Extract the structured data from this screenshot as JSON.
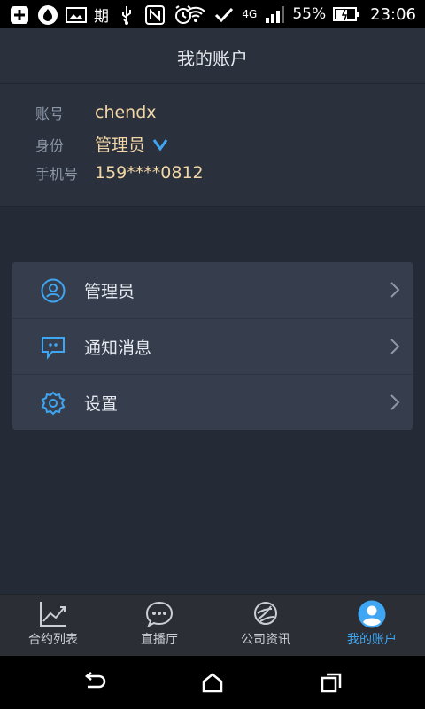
{
  "status_bar": {
    "carrier_label": "期",
    "network_type": "4G",
    "battery_percent": "55%",
    "time": "23:06",
    "icons": [
      "plus-badge-icon",
      "droplet-icon",
      "image-icon",
      "usb-icon",
      "nfc-icon",
      "alarm-icon",
      "wifi-icon",
      "check-icon",
      "signal-icon",
      "battery-icon"
    ]
  },
  "header": {
    "title": "我的账户"
  },
  "account": {
    "account_label": "账号",
    "account_value": "chendx",
    "role_label": "身份",
    "role_value": "管理员",
    "phone_label": "手机号",
    "phone_value": "159****0812"
  },
  "menu": {
    "items": [
      {
        "label": "管理员",
        "icon": "user-circle-icon"
      },
      {
        "label": "通知消息",
        "icon": "message-icon"
      },
      {
        "label": "设置",
        "icon": "gear-icon"
      }
    ]
  },
  "bottom_nav": {
    "items": [
      {
        "label": "合约列表",
        "icon": "chart-icon"
      },
      {
        "label": "直播厅",
        "icon": "chat-bubble-icon"
      },
      {
        "label": "公司资讯",
        "icon": "news-icon"
      },
      {
        "label": "我的账户",
        "icon": "user-icon",
        "active": true
      }
    ]
  },
  "colors": {
    "accent": "#3ea6f2",
    "value_text": "#f2d6a6",
    "background": "#252b36",
    "card": "#363e4d"
  }
}
